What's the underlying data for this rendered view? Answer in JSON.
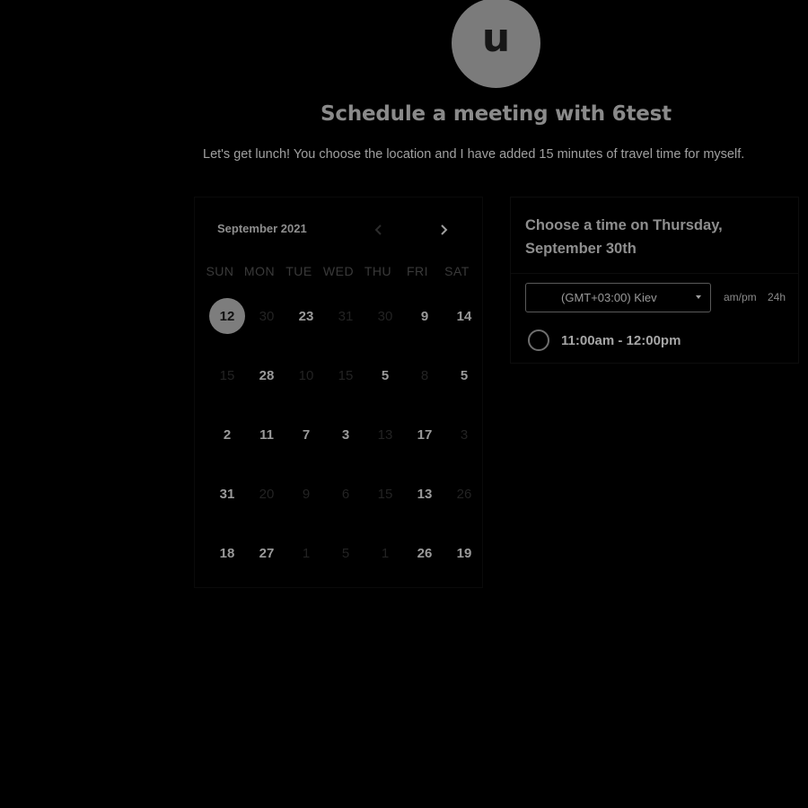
{
  "header": {
    "avatar_letter": "u",
    "title": "Schedule a meeting with 6test",
    "description": "Let's get lunch! You choose the location and I have added 15 minutes of travel time for myself."
  },
  "calendar": {
    "month_label": "September 2021",
    "prev_icon": "chevron-left-icon",
    "next_icon": "chevron-right-icon",
    "days_of_week": [
      "SUN",
      "MON",
      "TUE",
      "WED",
      "THU",
      "FRI",
      "SAT"
    ],
    "weeks": [
      [
        {
          "label": "12",
          "available": true,
          "selected": true
        },
        {
          "label": "30",
          "available": false
        },
        {
          "label": "23",
          "available": true
        },
        {
          "label": "31",
          "available": false
        },
        {
          "label": "30",
          "available": false
        },
        {
          "label": "9",
          "available": true
        },
        {
          "label": "14",
          "available": true
        }
      ],
      [
        {
          "label": "15",
          "available": false
        },
        {
          "label": "28",
          "available": true
        },
        {
          "label": "10",
          "available": false
        },
        {
          "label": "15",
          "available": false
        },
        {
          "label": "5",
          "available": true
        },
        {
          "label": "8",
          "available": false
        },
        {
          "label": "5",
          "available": true
        }
      ],
      [
        {
          "label": "2",
          "available": true
        },
        {
          "label": "11",
          "available": true
        },
        {
          "label": "7",
          "available": true
        },
        {
          "label": "3",
          "available": true
        },
        {
          "label": "13",
          "available": false
        },
        {
          "label": "17",
          "available": true
        },
        {
          "label": "3",
          "available": false
        }
      ],
      [
        {
          "label": "31",
          "available": true
        },
        {
          "label": "20",
          "available": false
        },
        {
          "label": "9",
          "available": false
        },
        {
          "label": "6",
          "available": false
        },
        {
          "label": "15",
          "available": false
        },
        {
          "label": "13",
          "available": true
        },
        {
          "label": "26",
          "available": false
        }
      ],
      [
        {
          "label": "18",
          "available": true
        },
        {
          "label": "27",
          "available": true
        },
        {
          "label": "1",
          "available": false
        },
        {
          "label": "5",
          "available": false
        },
        {
          "label": "1",
          "available": false
        },
        {
          "label": "26",
          "available": true
        },
        {
          "label": "19",
          "available": true
        }
      ]
    ]
  },
  "time_panel": {
    "heading": "Choose a time on Thursday, September 30th",
    "timezone": "(GMT+03:00) Kiev",
    "format_ampm": "am/pm",
    "format_24h": "24h",
    "slots": [
      "11:00am - 12:00pm"
    ]
  },
  "colors": {
    "background": "#000000",
    "selected_day": "#7d7d7d",
    "avatar": "#7b7b7b"
  }
}
